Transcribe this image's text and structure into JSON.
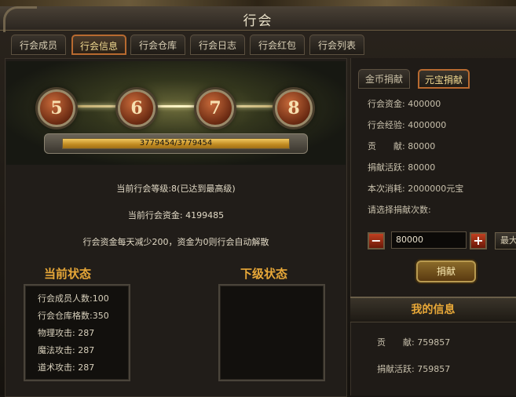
{
  "window": {
    "title": "行会"
  },
  "tabs": [
    {
      "label": "行会成员"
    },
    {
      "label": "行会信息",
      "active": true
    },
    {
      "label": "行会仓库"
    },
    {
      "label": "行会日志"
    },
    {
      "label": "行会红包"
    },
    {
      "label": "行会列表"
    }
  ],
  "levels": [
    "5",
    "6",
    "7",
    "8"
  ],
  "progress": {
    "text": "3779454/3779454",
    "fraction": 1.0
  },
  "info": {
    "level_line": "当前行会等级:8(已达到最高级)",
    "funds_line": "当前行会资金: 4199485",
    "rule_line": "行会资金每天减少200，资金为0则行会自动解散"
  },
  "current_status": {
    "heading": "当前状态",
    "rows": [
      "行会成员人数:100",
      "行会仓库格数:350",
      "物理攻击: 287",
      "魔法攻击: 287",
      "道术攻击: 287"
    ]
  },
  "next_status": {
    "heading": "下级状态"
  },
  "donate": {
    "tabs": [
      {
        "label": "金币捐献"
      },
      {
        "label": "元宝捐献",
        "active": true
      }
    ],
    "lines": [
      "行会资金: 400000",
      "行会经验: 4000000",
      "贡　　献: 80000",
      "捐献活跃: 80000",
      "本次消耗:  2000000元宝",
      "请选择捐献次数:"
    ],
    "minus": "−",
    "plus": "+",
    "amount": "80000",
    "max_label": "最大",
    "button": "捐献"
  },
  "my_info": {
    "title": "我的信息",
    "contribution": "贡　　献: 759857",
    "activity": "捐献活跃: 759857"
  }
}
